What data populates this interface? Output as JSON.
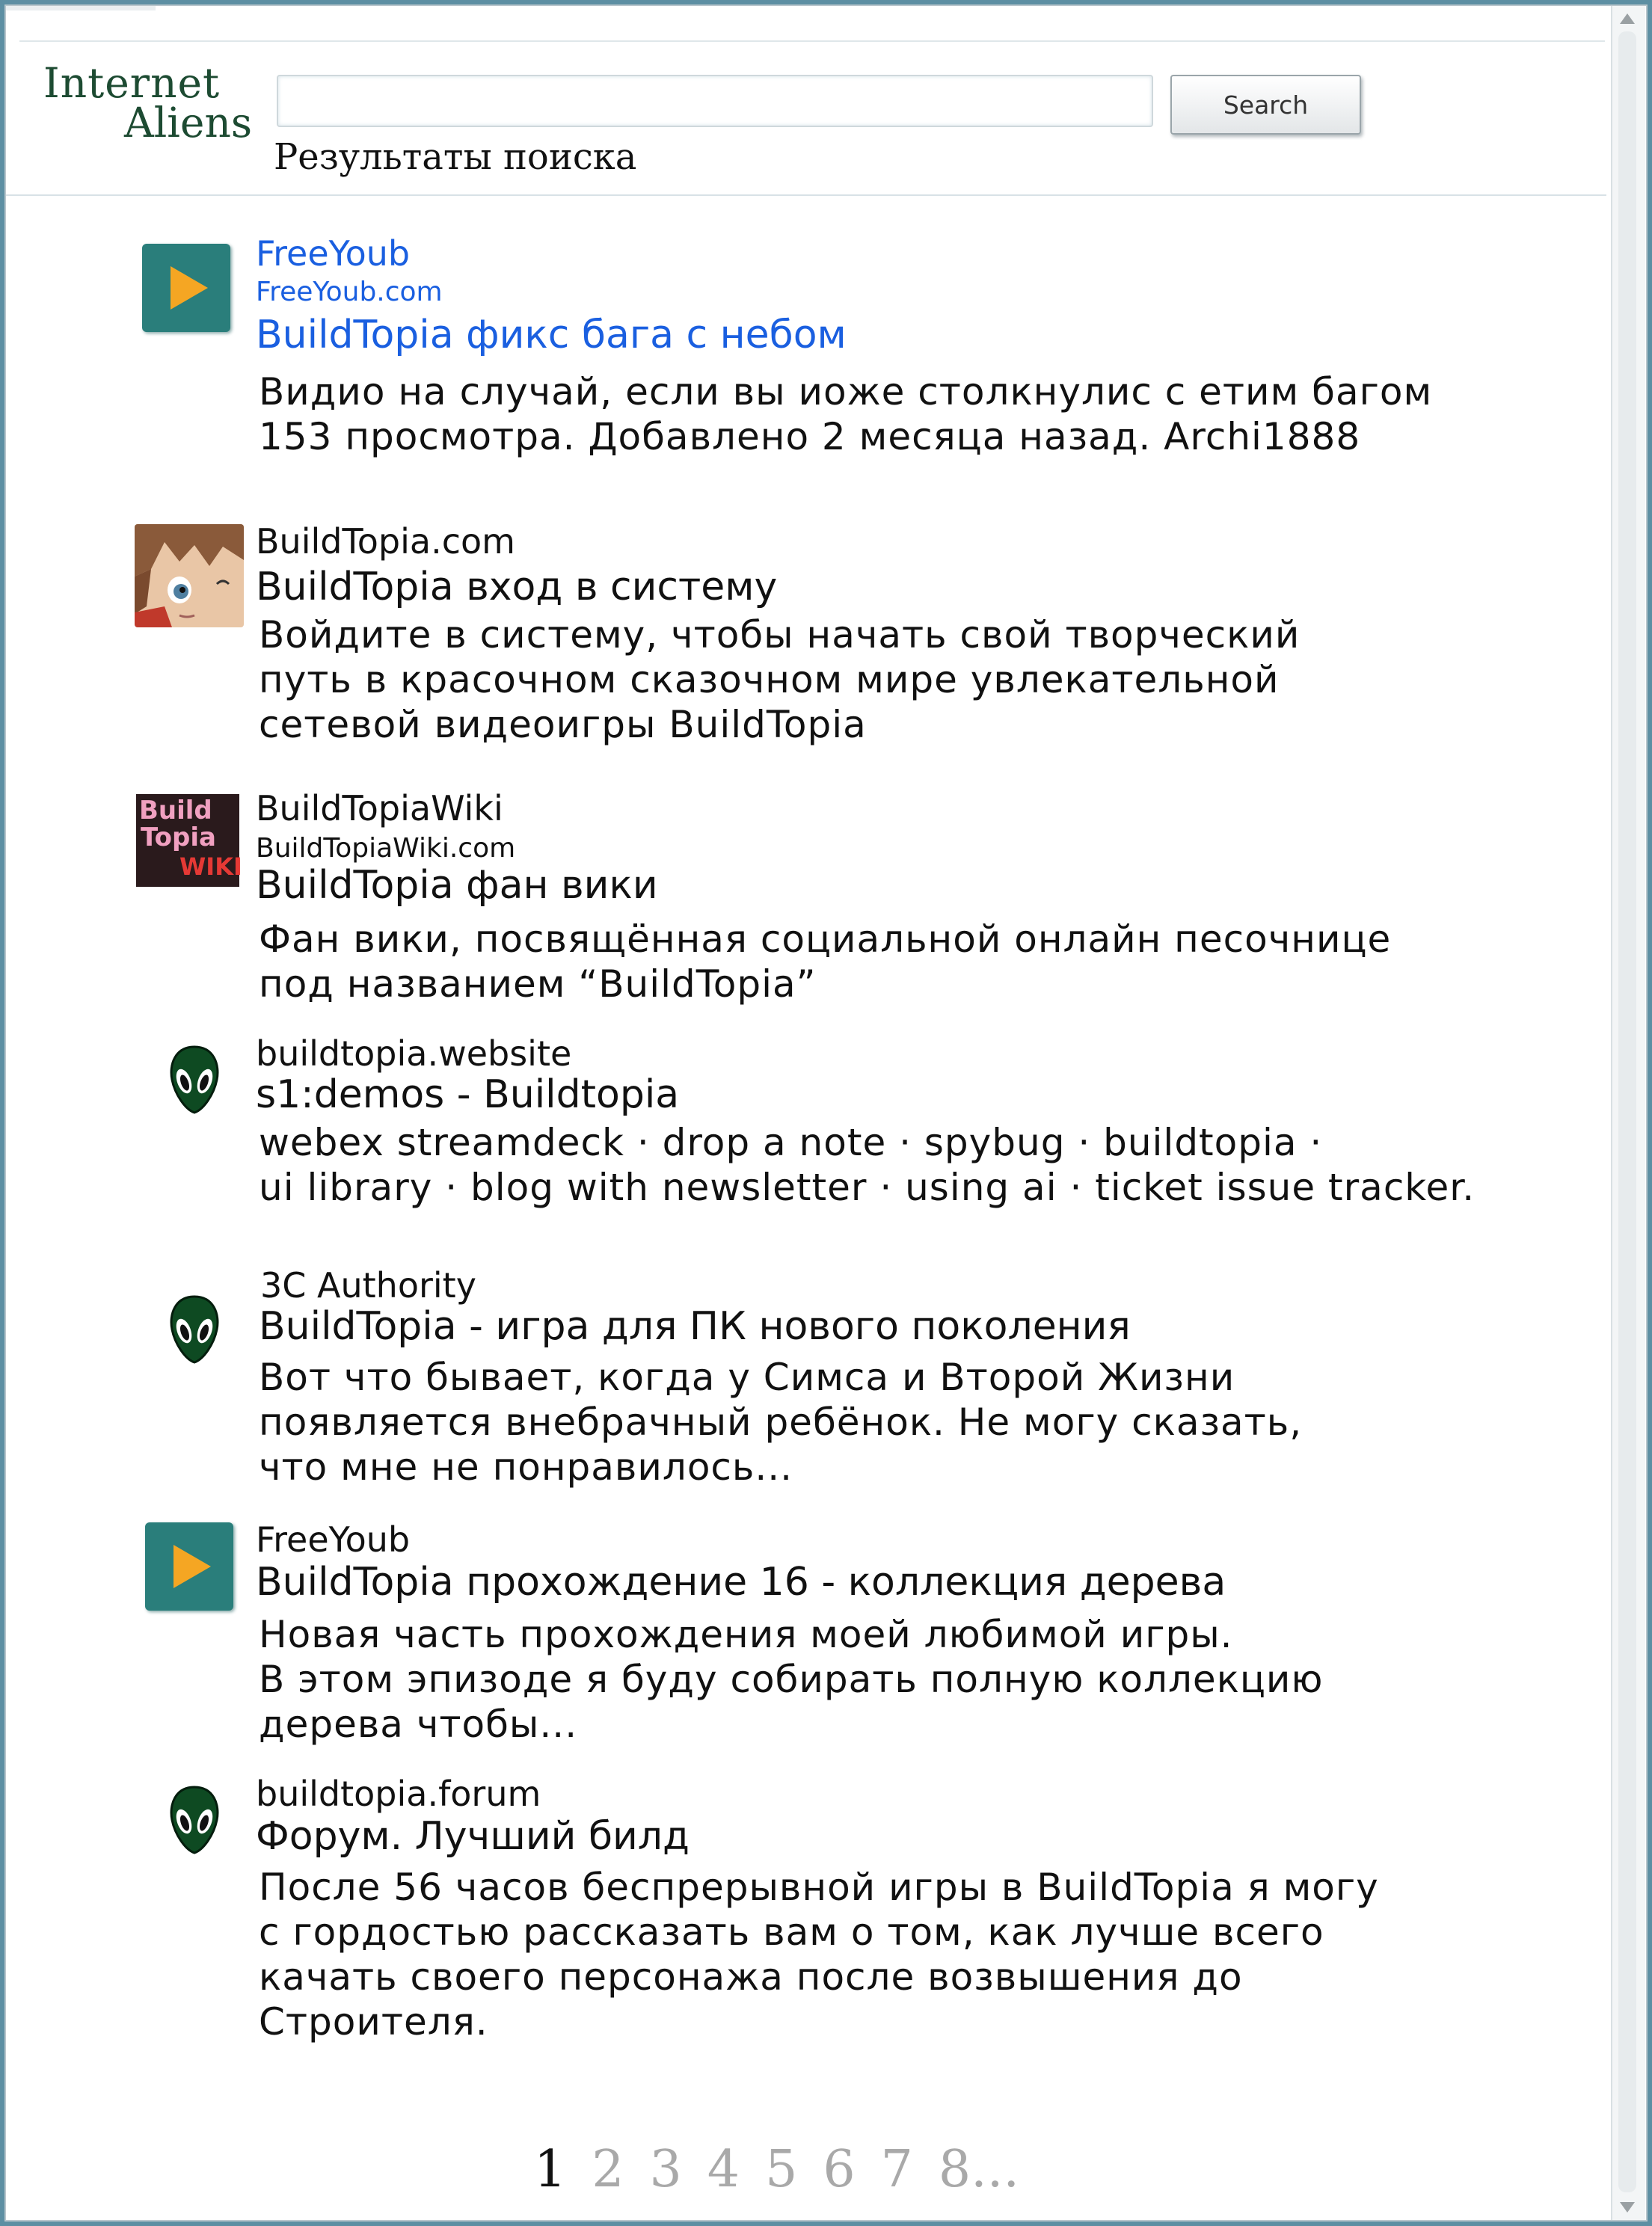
{
  "header": {
    "logo_line1": "Internet",
    "logo_line2": "Aliens",
    "search_value": "",
    "search_button": "Search",
    "results_title": "Результаты поиска"
  },
  "results": [
    {
      "site": "FreeYoub",
      "url": "FreeYoub.com",
      "title": "BuildTopia фикс бага с небом",
      "desc": "Видио на случай, если вы иоже столкнулис с етим багом\n153 просмотра. Добавлено 2 месяца назад. Archi1888",
      "icon": "play-icon"
    },
    {
      "site": "BuildTopia.com",
      "title": "BuildTopia вход в систему",
      "desc": "Войдите в систему, чтобы начать свой творческий\nпуть в красочном сказочном мире увлекательной\nсетевой видеоигры BuildTopia",
      "icon": "avatar"
    },
    {
      "site": "BuildTopiaWiki",
      "url": "BuildTopiaWiki.com",
      "title": "BuildTopia фан вики",
      "desc": "Фан вики, посвящённая социальной онлайн песочнице\nпод названием “BuildTopia”",
      "icon": "wiki-logo",
      "logo_text": [
        "Build",
        "Topia",
        "WIKI"
      ]
    },
    {
      "site": "buildtopia.website",
      "title": "s1:demos - Buildtopia",
      "desc": "webex streamdeck · drop a note · spybug · buildtopia ·\nui library · blog with newsletter · using ai · ticket issue tracker.",
      "icon": "alien-icon"
    },
    {
      "site": "3C Authority",
      "title": "BuildTopia - игра для ПК нового поколения",
      "desc": "Вот что бывает, когда у Симса и Второй Жизни\nпоявляется внебрачный ребёнок. Не могу сказать,\nчто мне не понравилось...",
      "icon": "alien-icon"
    },
    {
      "site": "FreeYoub",
      "title": "BuildTopia прохождение 16 - коллекция дерева",
      "desc": "Новая часть прохождения моей любимой игры.\nВ этом эпизоде я буду собирать полную коллекцию\nдерева чтобы...",
      "icon": "play-icon"
    },
    {
      "site": "buildtopia.forum",
      "title": "Форум. Лучший билд",
      "desc": "После 56 часов беспрерывной игры в BuildTopia я могу\nс гордостью рассказать вам о том, как лучше всего\nкачать своего персонажа после возвышения до\nСтроителя.",
      "icon": "alien-icon"
    }
  ],
  "pagination": {
    "pages": [
      "1",
      "2",
      "3",
      "4",
      "5",
      "6",
      "7",
      "8..."
    ],
    "current": "1"
  },
  "colors": {
    "link_blue": "#1a5fe0",
    "logo_green": "#1d4b32",
    "play_teal": "#2a7e7b",
    "play_orange": "#f5a623"
  }
}
